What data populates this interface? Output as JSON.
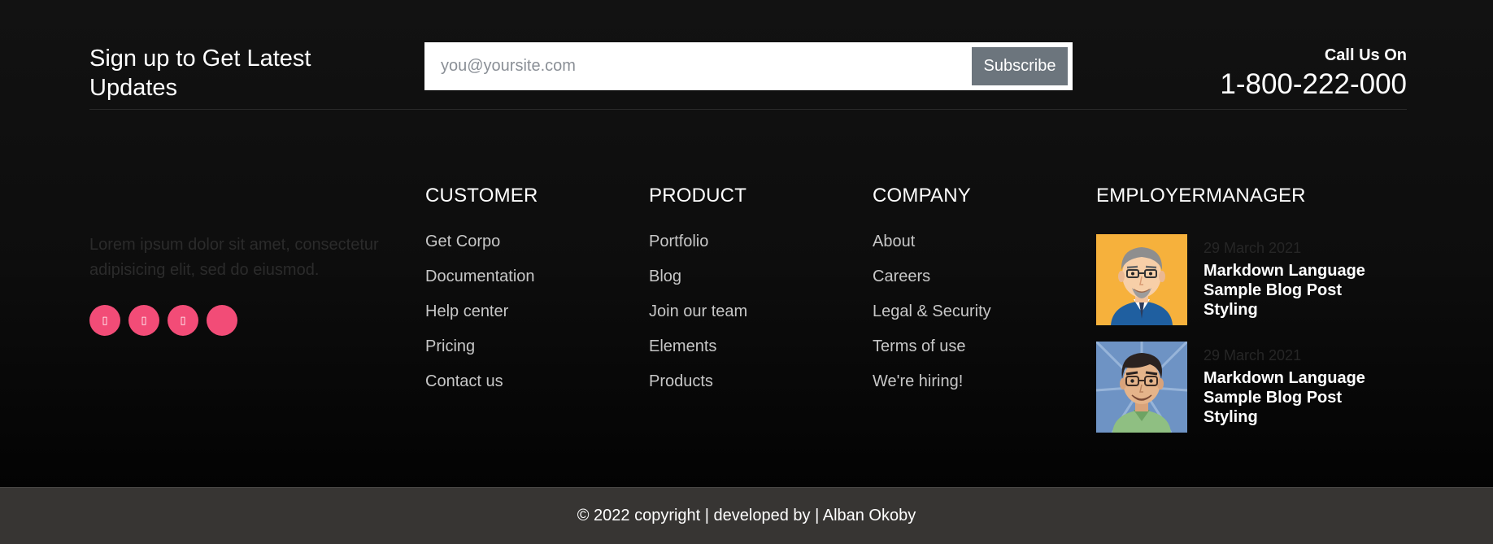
{
  "signup": {
    "title": "Sign up to Get Latest Updates",
    "email_placeholder": "you@yoursite.com",
    "subscribe_label": "Subscribe"
  },
  "contact": {
    "label": "Call Us On",
    "phone": "1-800-222-000"
  },
  "about": {
    "text": "Lorem ipsum dolor sit amet, consectetur adipisicing elit, sed do eiusmod.",
    "social_icons": [
      "facebook-icon",
      "twitter-icon",
      "instagram-icon",
      "linkedin-icon"
    ],
    "social_color": "#f24c77"
  },
  "columns": [
    {
      "title": "CUSTOMER",
      "links": [
        "Get Corpo",
        "Documentation",
        "Help center",
        "Pricing",
        "Contact us"
      ]
    },
    {
      "title": "PRODUCT",
      "links": [
        "Portfolio",
        "Blog",
        "Join our team",
        "Elements",
        "Products"
      ]
    },
    {
      "title": "COMPANY",
      "links": [
        "About",
        "Careers",
        "Legal & Security",
        "Terms of use",
        "We're hiring!"
      ]
    }
  ],
  "employer": {
    "title": "EMPLOYERMANAGER",
    "posts": [
      {
        "date": "29 March 2021",
        "title": "Markdown Language Sample Blog Post Styling",
        "avatar": "older-man-glasses-avatar"
      },
      {
        "date": "29 March 2021",
        "title": "Markdown Language Sample Blog Post Styling",
        "avatar": "young-man-glasses-avatar"
      }
    ]
  },
  "copyright": {
    "text": "© 2022 copyright | developed by | Alban Okoby"
  }
}
